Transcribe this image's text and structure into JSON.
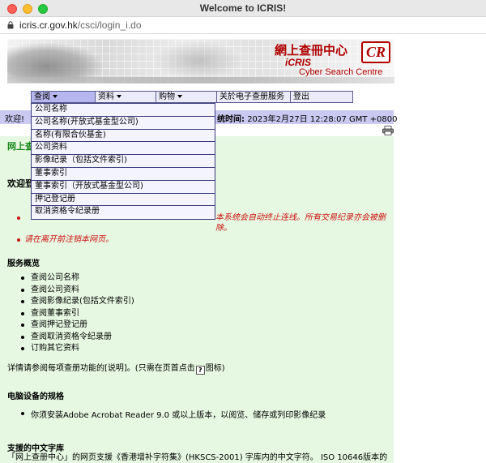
{
  "window": {
    "title": "Welcome to ICRIS!"
  },
  "address_bar": {
    "host": "icris.cr.gov.hk",
    "path": "/csci/login_i.do"
  },
  "banner": {
    "title_cn": "網上查冊中心",
    "title_en_line1": "iCRIS",
    "title_en_line2": "Cyber Search Centre",
    "logo_text": "CR",
    "brand_color": "#b00000"
  },
  "menu": {
    "items": [
      {
        "label": "查阅",
        "has_caret": true
      },
      {
        "label": "资料",
        "has_caret": true
      },
      {
        "label": "购物",
        "has_caret": true
      },
      {
        "label": "关於电子查册服务",
        "has_caret": false
      },
      {
        "label": "登出",
        "has_caret": false
      }
    ],
    "dropdown": [
      "公司名称",
      "公司名称(开放式基金型公司)",
      "名称(有限合伙基金)",
      "公司资料",
      "影像纪录（包括文件索引)",
      "董事索引",
      "董事索引（开放式基金型公司)",
      "押记登记册",
      "取消资格令纪录册"
    ]
  },
  "welcome_bar": {
    "greeting": "欢迎!",
    "system_time_label": "统时间:",
    "system_time_value": "2023年2月27日 12:28:07 GMT +0800"
  },
  "content": {
    "netlink_label": "网上查",
    "welcome_heading": "欢迎登",
    "red_notes": [
      "本系统会自动终止连线。所有交易纪录亦会被删除。",
      "请在离开前注销本网页。"
    ],
    "services_title": "服务概览",
    "services": [
      "查阅公司名称",
      "查阅公司资料",
      "查阅影像纪录(包括文件索引)",
      "查阅董事索引",
      "查阅押记登记册",
      "查阅取消资格令纪录册",
      "订购其它资料"
    ],
    "help_text_before": "详情请参阅每项查册功能的[说明]。(只需在页首点击",
    "help_text_after": "图标)",
    "help_icon_glyph": "?",
    "equipment_title": "电脑设备的规格",
    "equipment_note": "你须安装Adobe Acrobat Reader 9.0 或以上版本，以阅览、储存或列印影像纪录",
    "font_title": "支援的中文字库",
    "font_text": "「网上查册中心」的网页支援《香港增补字符集》(HKSCS-2001) 字库内的中文字符。 ISO 10646版本的"
  }
}
